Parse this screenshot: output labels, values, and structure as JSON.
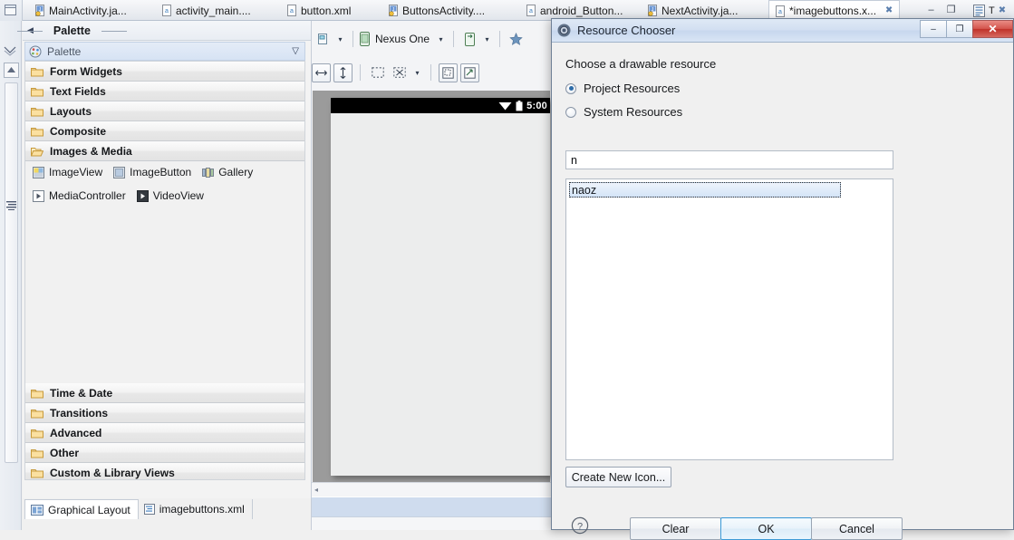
{
  "window": {
    "minimize_glyph": "–",
    "maximize_glyph": "❐"
  },
  "editor_tabs": [
    {
      "label": "MainActivity.ja...",
      "icon": "java-file-icon",
      "active": false,
      "closable": false
    },
    {
      "label": "activity_main....",
      "icon": "xml-file-icon",
      "active": false,
      "closable": false
    },
    {
      "label": "button.xml",
      "icon": "xml-file-icon",
      "active": false,
      "closable": false
    },
    {
      "label": "ButtonsActivity....",
      "icon": "java-file-icon",
      "active": false,
      "closable": false
    },
    {
      "label": "android_Button...",
      "icon": "xml-file-icon",
      "active": false,
      "closable": false
    },
    {
      "label": "NextActivity.ja...",
      "icon": "java-file-icon",
      "active": false,
      "closable": false
    },
    {
      "label": "*imagebuttons.x...",
      "icon": "xml-file-icon",
      "active": true,
      "closable": true,
      "close_glyph": "✖"
    }
  ],
  "palette": {
    "title": "Palette",
    "header_label": "Palette",
    "header_icon": "palette-icon",
    "collapse_glyph": "▽",
    "back_arrow_glyph": "◀",
    "categories_top": [
      {
        "label": "Form Widgets",
        "state": "closed"
      },
      {
        "label": "Text Fields",
        "state": "closed"
      },
      {
        "label": "Layouts",
        "state": "closed"
      },
      {
        "label": "Composite",
        "state": "closed"
      },
      {
        "label": "Images & Media",
        "state": "open"
      }
    ],
    "images_media_widgets": [
      {
        "label": "ImageView",
        "icon": "imageview-icon"
      },
      {
        "label": "ImageButton",
        "icon": "imagebutton-icon"
      },
      {
        "label": "Gallery",
        "icon": "gallery-icon"
      },
      {
        "label": "MediaController",
        "icon": "mediacontroller-icon"
      },
      {
        "label": "VideoView",
        "icon": "videoview-icon"
      }
    ],
    "categories_bottom": [
      {
        "label": "Time & Date",
        "state": "closed"
      },
      {
        "label": "Transitions",
        "state": "closed"
      },
      {
        "label": "Advanced",
        "state": "closed"
      },
      {
        "label": "Other",
        "state": "closed"
      },
      {
        "label": "Custom & Library Views",
        "state": "closed"
      }
    ]
  },
  "view_tabs": [
    {
      "label": "Graphical Layout",
      "icon": "graphical-layout-icon",
      "active": true
    },
    {
      "label": "imagebuttons.xml",
      "icon": "xml-source-icon",
      "active": false
    }
  ],
  "toolbar": {
    "config_icon": "config-icon",
    "device_label": "Nexus One",
    "device_icon": "phone-icon",
    "orientation_icon": "orientation-icon",
    "favorite_icon": "star-icon",
    "dropdown_glyph": "▾",
    "width_icon": "fit-width-icon",
    "height_icon": "fit-height-icon",
    "select_icon": "marquee-select-icon",
    "expand_icon": "expand-icon",
    "outline_icon": "show-outline-icon",
    "refresh_icon": "refresh-render-icon"
  },
  "device_preview": {
    "status_time": "5:00",
    "wifi_icon": "wifi-icon",
    "battery_icon": "battery-icon",
    "scroll_left_glyph": "◂"
  },
  "right_panel": {
    "outline_icon": "outline-icon",
    "text_icon": "text-T-icon",
    "close_icon": "close-icon",
    "thumbnail_name": "alarm-clock-drawable-preview"
  },
  "dialog": {
    "title": "Resource Chooser",
    "icon": "resource-chooser-icon",
    "prompt": "Choose a drawable resource",
    "radio_options": [
      {
        "label": "Project Resources",
        "selected": true
      },
      {
        "label": "System Resources",
        "selected": false
      }
    ],
    "search_value": "n",
    "list_items": [
      "naoz"
    ],
    "create_button": "Create New Icon...",
    "help_glyph": "?",
    "buttons": {
      "clear": "Clear",
      "ok": "OK",
      "cancel": "Cancel"
    },
    "window_buttons": {
      "minimize": "–",
      "maximize": "❐",
      "close": "✕"
    }
  },
  "colors": {
    "accent_blue": "#3d9ad6",
    "selection_blue": "#d4e4f7",
    "close_red": "#c0322a",
    "folder_yellow": "#f6d98a"
  }
}
